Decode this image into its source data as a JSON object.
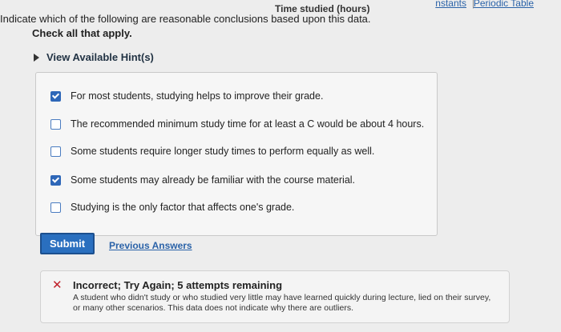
{
  "header": {
    "periodic_table_link": "Periodic Table",
    "separator": "|",
    "prev_link_fragment": "nstants",
    "axis_title": "Time studied (hours)"
  },
  "question": {
    "text": "Indicate which of the following are reasonable conclusions based upon this data.",
    "instruction": "Check all that apply."
  },
  "hint": {
    "label": "View Available Hint(s)"
  },
  "options": [
    {
      "label": "For most students, studying helps to improve their grade.",
      "checked": true
    },
    {
      "label": "The recommended minimum study time for at least a C would be about 4 hours.",
      "checked": false
    },
    {
      "label": "Some students require longer study times to perform equally as well.",
      "checked": false
    },
    {
      "label": "Some students may already be familiar with the course material.",
      "checked": true
    },
    {
      "label": "Studying is the only factor that affects one's grade.",
      "checked": false
    }
  ],
  "actions": {
    "submit_label": "Submit",
    "previous_answers_label": "Previous Answers"
  },
  "feedback": {
    "icon": "x-icon",
    "title": "Incorrect; Try Again; 5 attempts remaining",
    "text": "A student who didn't study or who studied very little may have learned quickly during lecture, lied on their survey, or many other scenarios. This data does not indicate why there are outliers."
  }
}
